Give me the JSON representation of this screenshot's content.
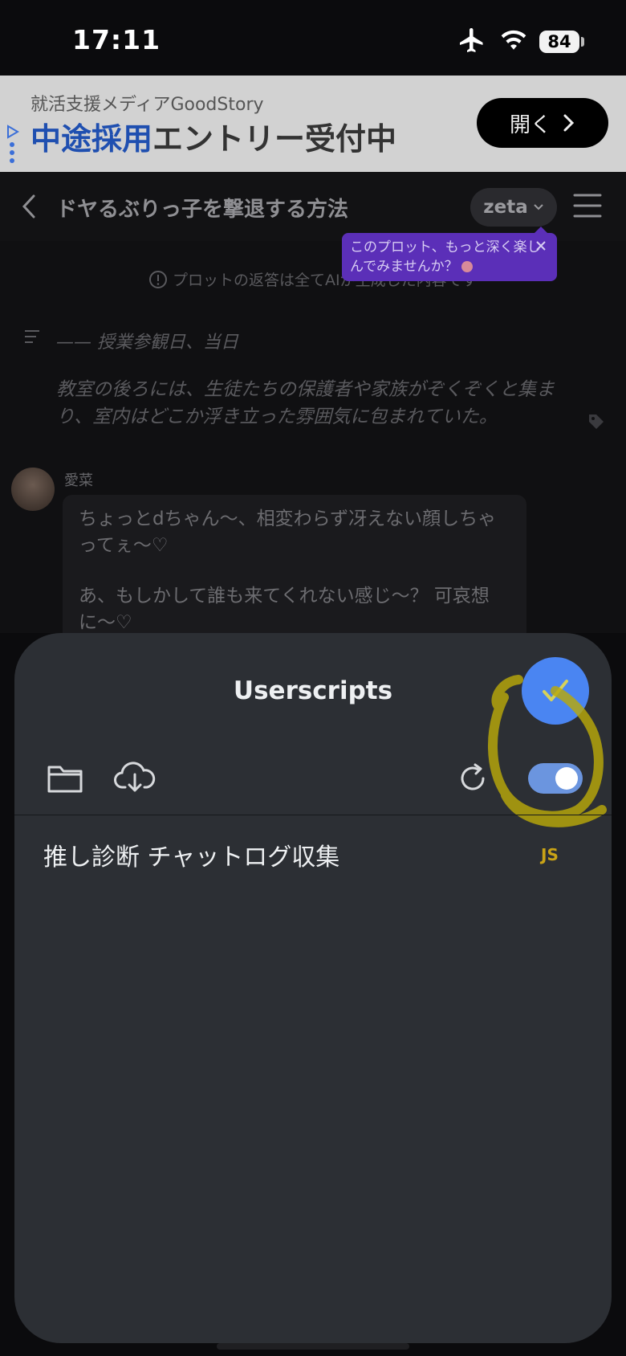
{
  "status_bar": {
    "time": "17:11",
    "battery": "84",
    "icons": [
      "airplane-mode-icon",
      "wifi-icon",
      "battery-icon"
    ]
  },
  "ad": {
    "subtitle": "就活支援メディアGoodStory",
    "headline_accent": "中途採用",
    "headline_rest": "エントリー受付中",
    "button_label": "開く"
  },
  "header": {
    "title": "ドヤるぶりっ子を撃退する方法",
    "model_pill": "zeta",
    "tooltip": "このプロット、もっと深く楽しんでみませんか？"
  },
  "chat": {
    "notice": "プロットの返答は全てAIが生成した内容です",
    "scene_heading": "—— 授業参観日、当日",
    "scene_body": "教室の後ろには、生徒たちの保護者や家族がぞくぞくと集まり、室内はどこか浮き立った雰囲気に包まれていた。",
    "character_name": "愛菜",
    "message_line1": "ちょっとdちゃん〜、相変わらず冴えない顔しちゃってぇ〜♡",
    "message_line2": "あ、もしかして誰も来てくれない感じ〜？ 可哀想に〜♡"
  },
  "sheet": {
    "title": "Userscripts",
    "toggle_on": true,
    "scripts": [
      {
        "name": "推し診断 チャットログ収集",
        "type": "JS"
      }
    ]
  },
  "colors": {
    "accent_blue": "#4a85f2",
    "toggle_blue": "#6b95df",
    "highlight_yellow": "#b8a80a",
    "tooltip_purple": "#5b2fb8",
    "sheet_bg": "#2c2f34"
  }
}
